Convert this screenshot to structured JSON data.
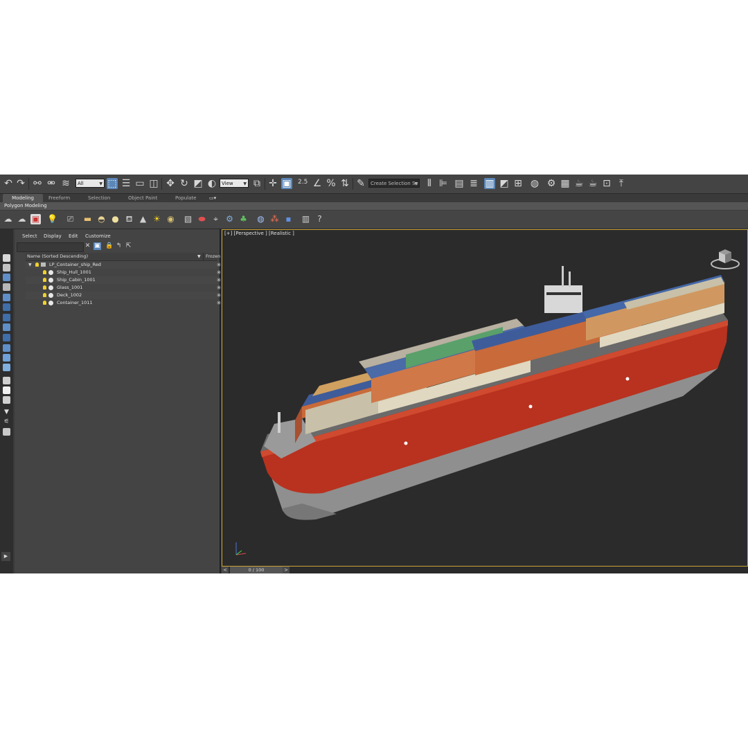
{
  "toolbar": {
    "selection_filter": "All",
    "reference_coordinate": "View",
    "snap_toggle": "2.5",
    "named_selection_placeholder": "Create Selection Se"
  },
  "ribbon": {
    "tabs": [
      "Modeling",
      "Freeform",
      "Selection",
      "Object Paint",
      "Populate"
    ],
    "active_tab": "Modeling",
    "panel_label": "Polygon Modeling"
  },
  "scene_explorer": {
    "menu": [
      "Select",
      "Display",
      "Edit",
      "Customize"
    ],
    "columns": {
      "name": "Name (Sorted Descending)",
      "frozen": "Frozen"
    },
    "root": "LP_Container_ship_Red",
    "children": [
      "Ship_Hull_1001",
      "Ship_Cabin_1001",
      "Glass_1001",
      "Deck_1002",
      "Container_1011"
    ]
  },
  "viewport": {
    "label": "[+] [Perspective ] [Realistic ]",
    "highlight_color": "#c9a437",
    "hull_color": "#b8321f"
  },
  "timeline": {
    "frame_readout": "0 / 100",
    "prev_label": "<",
    "next_label": ">"
  },
  "colors": {
    "accent": "#5b87b8",
    "ui_bg": "#444444",
    "viewport_bg": "#2b2b2b"
  }
}
